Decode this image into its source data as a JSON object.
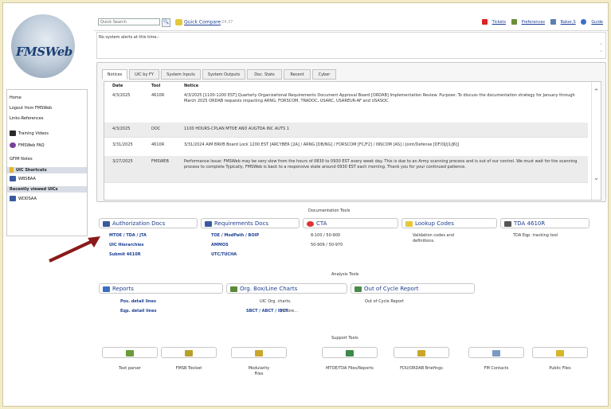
{
  "app": {
    "logo_text": "FMSWeb"
  },
  "top": {
    "search_placeholder": "Quick Search",
    "quick_compare": "Quick Compare",
    "version": "24.37",
    "links": [
      "Tickets",
      "Preferences",
      "Baker,S",
      "Guide"
    ]
  },
  "alerts": {
    "text": "No system alerts at this time.-"
  },
  "sidebar": {
    "links": [
      "Home",
      "Logout from FMSWeb",
      "Links-References"
    ],
    "training": "Training Videos",
    "faq": "FMSWeb FAQ",
    "gfim": "GFIM Notes",
    "uic_shortcuts_header": "UIC Shortcuts",
    "uic_shortcut": "WBSBAA",
    "recent_header": "Recently viewed UICs",
    "recent_uic": "WDDSAA"
  },
  "tabs": [
    "Notices",
    "UIC by FY",
    "System Inputs",
    "System Outputs",
    "Doc. Stats",
    "Recent",
    "Cyber"
  ],
  "notices": {
    "headers": [
      "Date",
      "Tool",
      "Notice"
    ],
    "rows": [
      {
        "date": "4/3/2025",
        "tool": "4610R",
        "notice": "4/3/2025 [1100-1200 EST] Quarterly Organizational Requirements Document Approval Board [ORDAB] Implementation Review. Purpose: To discuss the documentation strategy for January through March 2025 ORDAB requests impacting ARNG, FORSCOM, TRADOC, USARC, USAREUR-AF and USASOC."
      },
      {
        "date": "4/3/2025",
        "tool": "DOC",
        "notice": "1100 HOURS-CPLAN MTOE AND AUGTDA INC AUTS 1"
      },
      {
        "date": "3/31/2025",
        "tool": "4610R",
        "notice": "3/31/2024 AIM BRVB Board Lock 1200 EST [ARCYBER [2A] / ARNG [DB/NG] / FORSCOM [FC/F2] / INSCOM [AS] / Joint/Defense [DF/DJ/J1/J6]]"
      },
      {
        "date": "3/27/2025",
        "tool": "FMSWEB",
        "notice": "Performance Issue: FMSWeb may be very slow from the hours of 0830 to 0930 EST every week day. This is due to an Army scanning process and is out of our control. We must wait for the scanning process to complete Typically, FMSWeb is back to a responsive state around 0930 EST each morning. Thank you for your continued patience."
      }
    ]
  },
  "doc_tools": {
    "title": "Documentation Tools",
    "auth": {
      "label": "Authorization Docs",
      "links": [
        "MTOE / TDA / JTA",
        "UIC Hierarchies",
        "Submit 4610R"
      ]
    },
    "req": {
      "label": "Requirements Docs",
      "links": [
        "TOE / ModPath / BOIP",
        "AMMOS",
        "UTC/TUCHA"
      ]
    },
    "cta": {
      "label": "CTA",
      "items": [
        "8-100 / 50-900",
        "50-909 / 50-970"
      ]
    },
    "lookup": {
      "label": "Lookup Codes",
      "items": [
        "Validation codes and",
        "definitions."
      ]
    },
    "tda": {
      "label": "TDA 4610R",
      "items": [
        "TDA Eqp. tracking tool"
      ]
    }
  },
  "analysis_tools": {
    "title": "Analysis Tools",
    "reports": {
      "label": "Reports",
      "links": [
        "Pos. detail lines",
        "Eqp. detail lines"
      ]
    },
    "org": {
      "label": "Org. Box/Line Charts",
      "desc": "UIC Org. charts.",
      "links": "SBCT / ABCT / IBCT",
      "more": " / more..."
    },
    "ooc": {
      "label": "Out of Cycle Report",
      "desc": "Out of Cycle Report"
    }
  },
  "support_tools": {
    "title": "Support Tools",
    "items": [
      "Text parser",
      "FMSB Toolset",
      "Modularity",
      "MTOE/TDA Files/Reports",
      "FDU/ORDAB Briefings",
      "FM Contacts",
      "Public Files"
    ],
    "modularity_line2": "Files"
  },
  "colors": {
    "link": "#1c3f94",
    "background": "#f3ecc8",
    "arrow": "#8b1a1a"
  }
}
